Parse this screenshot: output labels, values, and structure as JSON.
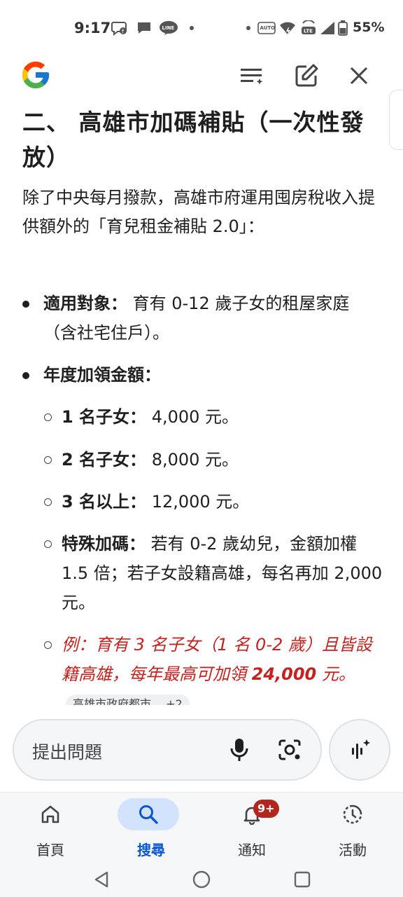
{
  "status_bar": {
    "time": "9:17",
    "battery_percent": "55%",
    "left_icons": [
      "chat-bubble-f-icon",
      "chat-bubble-icon",
      "line-app-icon"
    ],
    "right_icons": [
      "auto-hd-icon",
      "wifi-icon",
      "volte-lte-icon",
      "signal-icon",
      "battery-icon"
    ]
  },
  "top_bar": {
    "logo": "google-g-logo",
    "actions": [
      "history-icon",
      "edit-icon",
      "close-icon"
    ]
  },
  "article": {
    "heading": "二、 高雄市加碼補貼（一次性發放）",
    "intro": "除了中央每月撥款，高雄市府運用囤房稅收入提供額外的「育兒租金補貼 2.0」：",
    "bullets": [
      {
        "label": "適用對象：",
        "text": " 育有 0-12 歲子女的租屋家庭（含社宅住戶）。"
      },
      {
        "label": "年度加領金額：",
        "text": ""
      }
    ],
    "sub_items": [
      {
        "label": "1 名子女：",
        "text": " 4,000 元。"
      },
      {
        "label": "2 名子女：",
        "text": " 8,000 元。"
      },
      {
        "label": "3 名以上：",
        "text": " 12,000 元。"
      },
      {
        "label": "特殊加碼：",
        "text": " 若有 0-2 歲幼兒，金額加權 1.5 倍；若子女設籍高雄，每名再加 2,000 元。"
      }
    ],
    "example": {
      "text": "例：育有 3 名子女（1 名 0-2 歲）且皆設籍高雄，每年最高可加領 ",
      "amount": "24,000",
      "suffix": " 元。",
      "source": "高雄市政府都市…",
      "source_count": "+2"
    }
  },
  "ask_bar": {
    "placeholder": "提出問題"
  },
  "bottom_nav": {
    "items": [
      {
        "label": "首頁",
        "icon": "home-icon"
      },
      {
        "label": "搜尋",
        "icon": "search-icon",
        "active": true
      },
      {
        "label": "通知",
        "icon": "bell-icon",
        "badge": "9+"
      },
      {
        "label": "活動",
        "icon": "activity-icon"
      }
    ]
  },
  "colors": {
    "accent": "#0b57d0",
    "active_pill": "#d3e3fd",
    "example_red": "#c5221f",
    "badge_red": "#b3261e"
  }
}
